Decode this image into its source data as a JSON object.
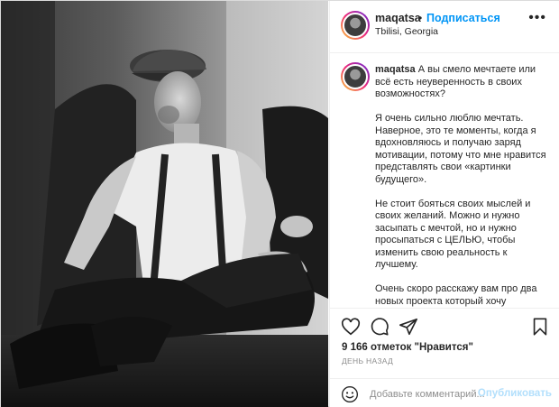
{
  "post": {
    "username": "maqatsa",
    "separator": "•",
    "follow_label": "Подписаться",
    "location": "Tbilisi, Georgia",
    "more_label": "•••",
    "caption": {
      "username": "maqatsa",
      "lead": "А вы смело мечтаете или всё есть неуверенность в своих возможностях?",
      "paragraphs": [
        "Я очень сильно люблю мечтать. Наверное, это те моменты, когда я вдохновляюсь и получаю заряд мотивации, потому что мне нравится представлять свои «картинки будущего».",
        "Не стоит бояться своих мыслей и своих желаний. Можно и нужно засыпать с мечтой, но и нужно просыпаться с ЦЕЛЬЮ, чтобы изменить свою реальность к лучшему.",
        "Очень скоро расскажу вам про два новых проекта который хочу"
      ]
    },
    "icons": {
      "like": "heart-icon",
      "comment": "comment-icon",
      "share": "share-icon",
      "save": "bookmark-icon",
      "emoji": "emoji-icon"
    },
    "likes_text": "9 166 отметок \"Нравится\"",
    "timestamp": "ДЕНЬ НАЗАД",
    "comment": {
      "placeholder": "Добавьте комментарий...",
      "value": "",
      "publish_label": "Опубликовать"
    },
    "colors": {
      "accent": "#0095f6",
      "publish_disabled": "#b2dffc",
      "muted": "#8e8e8e",
      "text": "#262626"
    }
  }
}
